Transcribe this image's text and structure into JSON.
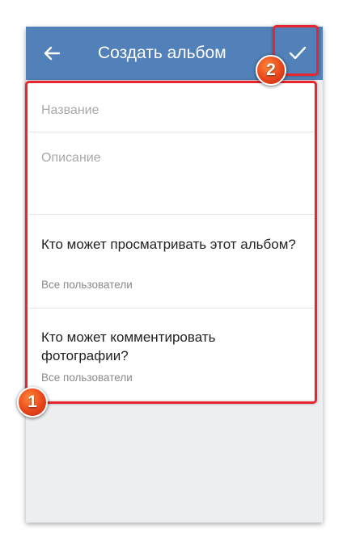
{
  "toolbar": {
    "back_icon": "arrow-left-icon",
    "title": "Создать альбом",
    "confirm_icon": "checkmark-icon"
  },
  "form": {
    "name_placeholder": "Название",
    "description_placeholder": "Описание"
  },
  "privacy": [
    {
      "title": "Кто может просматривать этот альбом?",
      "value": "Все пользователи"
    },
    {
      "title": "Кто может комментировать фотографии?",
      "value": "Все пользователи"
    }
  ],
  "annotations": {
    "form_marker": "1",
    "confirm_marker": "2"
  },
  "colors": {
    "toolbar": "#5181b8",
    "highlight": "#e8262e",
    "marker": "#e8451c"
  }
}
